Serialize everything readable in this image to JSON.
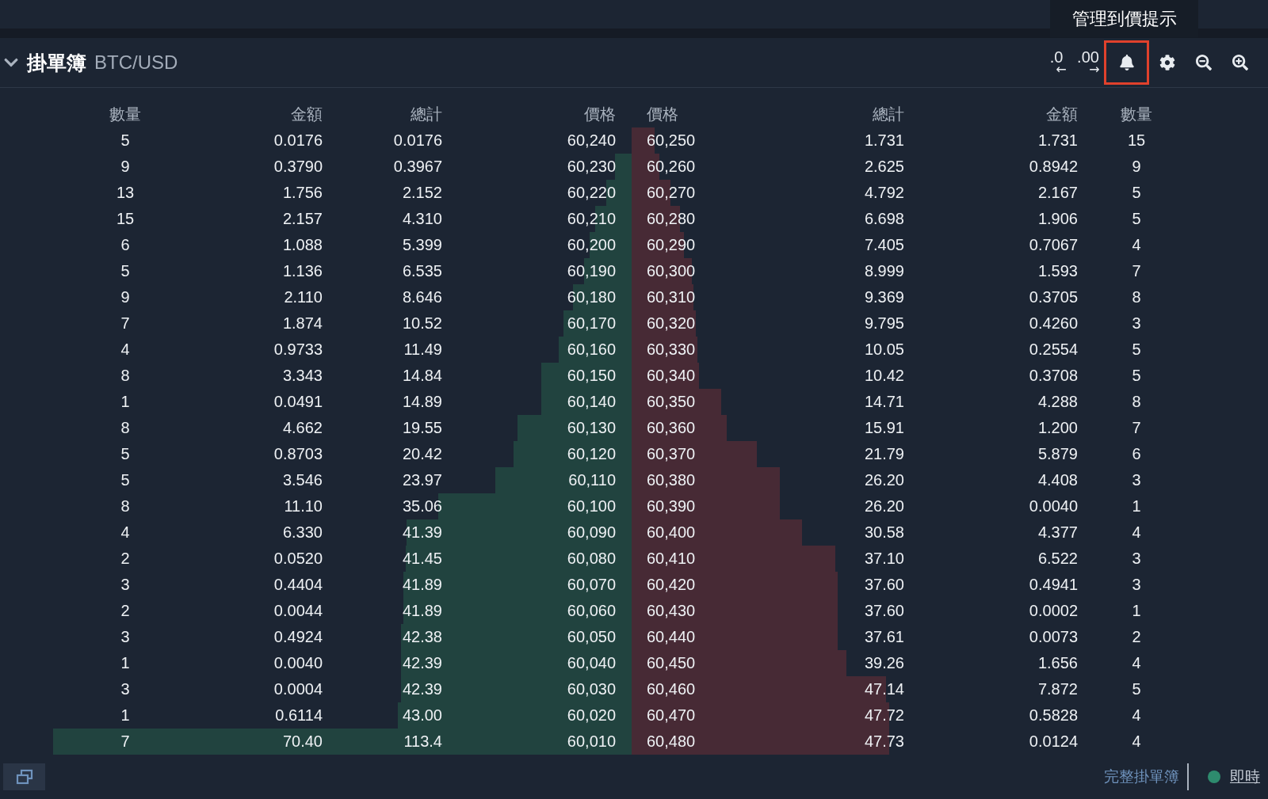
{
  "tooltip": "管理到價提示",
  "header": {
    "expanded": true,
    "title": "掛單簿",
    "pair": "BTC/USD"
  },
  "toolbar": [
    {
      "kind": "decimals",
      "text": ".0",
      "arrow": "←",
      "highlighted": false
    },
    {
      "kind": "decimals",
      "text": ".00",
      "arrow": "→",
      "highlighted": false
    },
    {
      "kind": "alert",
      "highlighted": true
    },
    {
      "kind": "settings",
      "highlighted": false
    },
    {
      "kind": "zoom-out",
      "highlighted": false
    },
    {
      "kind": "zoom-in",
      "highlighted": false
    }
  ],
  "bid_columns": [
    "數量",
    "金額",
    "總計",
    "價格"
  ],
  "ask_columns": [
    "價格",
    "總計",
    "金額",
    "數量"
  ],
  "rows": [
    {
      "bid": {
        "qty": "5",
        "amount": "0.0176",
        "total": "0.0176",
        "price": "60,240"
      },
      "ask": {
        "price": "60,250",
        "total": "1.731",
        "amount": "1.731",
        "qty": "15"
      }
    },
    {
      "bid": {
        "qty": "9",
        "amount": "0.3790",
        "total": "0.3967",
        "price": "60,230"
      },
      "ask": {
        "price": "60,260",
        "total": "2.625",
        "amount": "0.8942",
        "qty": "9"
      }
    },
    {
      "bid": {
        "qty": "13",
        "amount": "1.756",
        "total": "2.152",
        "price": "60,220"
      },
      "ask": {
        "price": "60,270",
        "total": "4.792",
        "amount": "2.167",
        "qty": "5"
      }
    },
    {
      "bid": {
        "qty": "15",
        "amount": "2.157",
        "total": "4.310",
        "price": "60,210"
      },
      "ask": {
        "price": "60,280",
        "total": "6.698",
        "amount": "1.906",
        "qty": "5"
      }
    },
    {
      "bid": {
        "qty": "6",
        "amount": "1.088",
        "total": "5.399",
        "price": "60,200"
      },
      "ask": {
        "price": "60,290",
        "total": "7.405",
        "amount": "0.7067",
        "qty": "4"
      }
    },
    {
      "bid": {
        "qty": "5",
        "amount": "1.136",
        "total": "6.535",
        "price": "60,190"
      },
      "ask": {
        "price": "60,300",
        "total": "8.999",
        "amount": "1.593",
        "qty": "7"
      }
    },
    {
      "bid": {
        "qty": "9",
        "amount": "2.110",
        "total": "8.646",
        "price": "60,180"
      },
      "ask": {
        "price": "60,310",
        "total": "9.369",
        "amount": "0.3705",
        "qty": "8"
      }
    },
    {
      "bid": {
        "qty": "7",
        "amount": "1.874",
        "total": "10.52",
        "price": "60,170"
      },
      "ask": {
        "price": "60,320",
        "total": "9.795",
        "amount": "0.4260",
        "qty": "3"
      }
    },
    {
      "bid": {
        "qty": "4",
        "amount": "0.9733",
        "total": "11.49",
        "price": "60,160"
      },
      "ask": {
        "price": "60,330",
        "total": "10.05",
        "amount": "0.2554",
        "qty": "5"
      }
    },
    {
      "bid": {
        "qty": "8",
        "amount": "3.343",
        "total": "14.84",
        "price": "60,150"
      },
      "ask": {
        "price": "60,340",
        "total": "10.42",
        "amount": "0.3708",
        "qty": "5"
      }
    },
    {
      "bid": {
        "qty": "1",
        "amount": "0.0491",
        "total": "14.89",
        "price": "60,140"
      },
      "ask": {
        "price": "60,350",
        "total": "14.71",
        "amount": "4.288",
        "qty": "8"
      }
    },
    {
      "bid": {
        "qty": "8",
        "amount": "4.662",
        "total": "19.55",
        "price": "60,130"
      },
      "ask": {
        "price": "60,360",
        "total": "15.91",
        "amount": "1.200",
        "qty": "7"
      }
    },
    {
      "bid": {
        "qty": "5",
        "amount": "0.8703",
        "total": "20.42",
        "price": "60,120"
      },
      "ask": {
        "price": "60,370",
        "total": "21.79",
        "amount": "5.879",
        "qty": "6"
      }
    },
    {
      "bid": {
        "qty": "5",
        "amount": "3.546",
        "total": "23.97",
        "price": "60,110"
      },
      "ask": {
        "price": "60,380",
        "total": "26.20",
        "amount": "4.408",
        "qty": "3"
      }
    },
    {
      "bid": {
        "qty": "8",
        "amount": "11.10",
        "total": "35.06",
        "price": "60,100"
      },
      "ask": {
        "price": "60,390",
        "total": "26.20",
        "amount": "0.0040",
        "qty": "1"
      }
    },
    {
      "bid": {
        "qty": "4",
        "amount": "6.330",
        "total": "41.39",
        "price": "60,090"
      },
      "ask": {
        "price": "60,400",
        "total": "30.58",
        "amount": "4.377",
        "qty": "4"
      }
    },
    {
      "bid": {
        "qty": "2",
        "amount": "0.0520",
        "total": "41.45",
        "price": "60,080"
      },
      "ask": {
        "price": "60,410",
        "total": "37.10",
        "amount": "6.522",
        "qty": "3"
      }
    },
    {
      "bid": {
        "qty": "3",
        "amount": "0.4404",
        "total": "41.89",
        "price": "60,070"
      },
      "ask": {
        "price": "60,420",
        "total": "37.60",
        "amount": "0.4941",
        "qty": "3"
      }
    },
    {
      "bid": {
        "qty": "2",
        "amount": "0.0044",
        "total": "41.89",
        "price": "60,060"
      },
      "ask": {
        "price": "60,430",
        "total": "37.60",
        "amount": "0.0002",
        "qty": "1"
      }
    },
    {
      "bid": {
        "qty": "3",
        "amount": "0.4924",
        "total": "42.38",
        "price": "60,050"
      },
      "ask": {
        "price": "60,440",
        "total": "37.61",
        "amount": "0.0073",
        "qty": "2"
      }
    },
    {
      "bid": {
        "qty": "1",
        "amount": "0.0040",
        "total": "42.39",
        "price": "60,040"
      },
      "ask": {
        "price": "60,450",
        "total": "39.26",
        "amount": "1.656",
        "qty": "4"
      }
    },
    {
      "bid": {
        "qty": "3",
        "amount": "0.0004",
        "total": "42.39",
        "price": "60,030"
      },
      "ask": {
        "price": "60,460",
        "total": "47.14",
        "amount": "7.872",
        "qty": "5"
      }
    },
    {
      "bid": {
        "qty": "1",
        "amount": "0.6114",
        "total": "43.00",
        "price": "60,020"
      },
      "ask": {
        "price": "60,470",
        "total": "47.72",
        "amount": "0.5828",
        "qty": "4"
      }
    },
    {
      "bid": {
        "qty": "7",
        "amount": "70.40",
        "total": "113.4",
        "price": "60,010"
      },
      "ask": {
        "price": "60,480",
        "total": "47.73",
        "amount": "0.0124",
        "qty": "4"
      }
    }
  ],
  "footer": {
    "full_book_link": "完整掛單簿",
    "status": "即時",
    "connected": true
  }
}
